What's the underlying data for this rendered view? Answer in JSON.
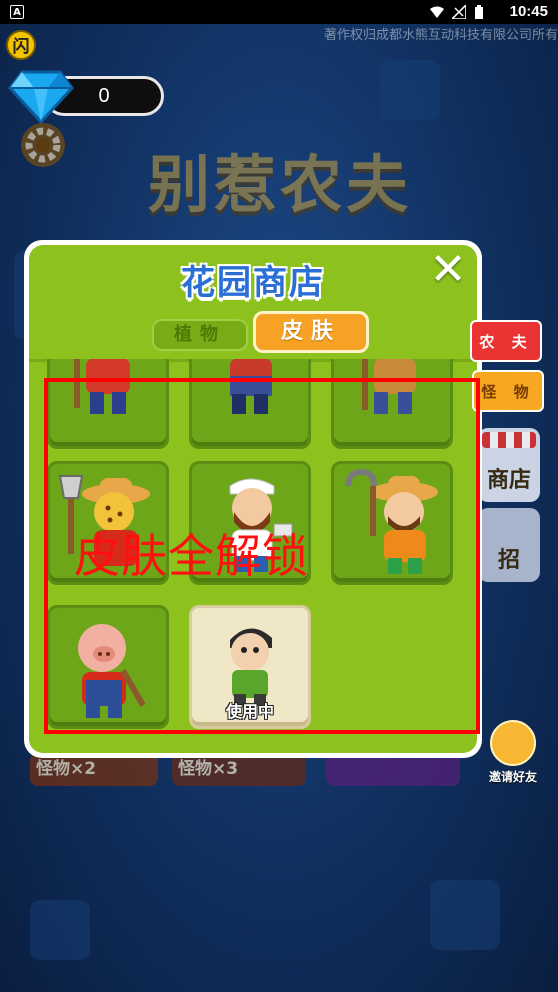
{
  "status_bar": {
    "time": "10:45"
  },
  "copyright": "著作权归成都水熊互动科技有限公司所有",
  "logo_badge": "闪",
  "currency": {
    "gem_count": "0"
  },
  "game_title": "别惹农夫",
  "shop": {
    "title": "花园商店",
    "close_label": "✕",
    "tabs": [
      {
        "label": "植物",
        "active": false
      },
      {
        "label": "皮肤",
        "active": true
      }
    ],
    "skins": [
      {
        "name": "red-shirt-farmer",
        "in_use": false
      },
      {
        "name": "overalls-farmer",
        "in_use": false
      },
      {
        "name": "bearded-farmer",
        "in_use": false
      },
      {
        "name": "leopard-farmer",
        "in_use": false
      },
      {
        "name": "bandana-farmer",
        "in_use": false
      },
      {
        "name": "sickle-farmer",
        "in_use": false
      },
      {
        "name": "pig-farmer",
        "in_use": false
      },
      {
        "name": "boy-farmer",
        "in_use": true,
        "badge": "使用中"
      }
    ]
  },
  "side_tabs": {
    "farmer": "农 夫",
    "monster": "怪 物"
  },
  "background": {
    "shop_button": "商店",
    "recruit_button": "招",
    "invite_label": "邀请好友",
    "monster_x2": "怪物×2",
    "monster_x3": "怪物×3"
  },
  "overlay_text": "皮肤全解锁",
  "colors": {
    "panel_green": "#8cc11e",
    "tab_orange": "#f8a225",
    "title_blue": "#2a6fd6",
    "overlay_red": "#ff0000"
  }
}
